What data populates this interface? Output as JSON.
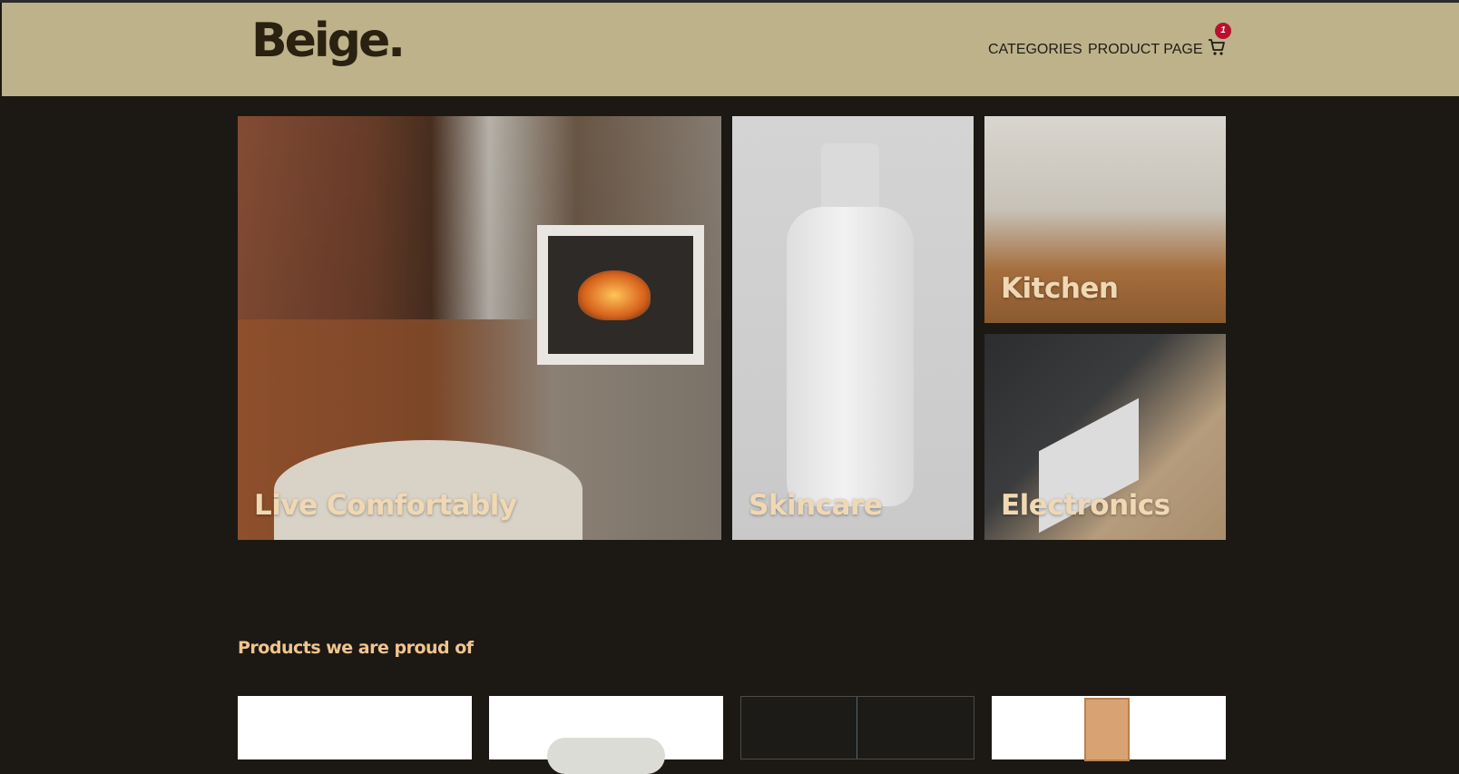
{
  "header": {
    "logo_text": "Beige.",
    "nav": [
      {
        "label": "CATEGORIES"
      },
      {
        "label": "PRODUCT PAGE"
      }
    ],
    "cart": {
      "icon": "cart-icon",
      "count": "1"
    }
  },
  "hero_tiles": [
    {
      "title": "Live Comfortably"
    },
    {
      "title": "Skincare"
    },
    {
      "title": "Kitchen"
    },
    {
      "title": "Electronics"
    }
  ],
  "products_section": {
    "title": "Products we are proud of"
  },
  "colors": {
    "header_bg": "#beb28b",
    "page_bg": "#1c1914",
    "accent_text": "#f1c58f",
    "badge": "#b8112d"
  }
}
